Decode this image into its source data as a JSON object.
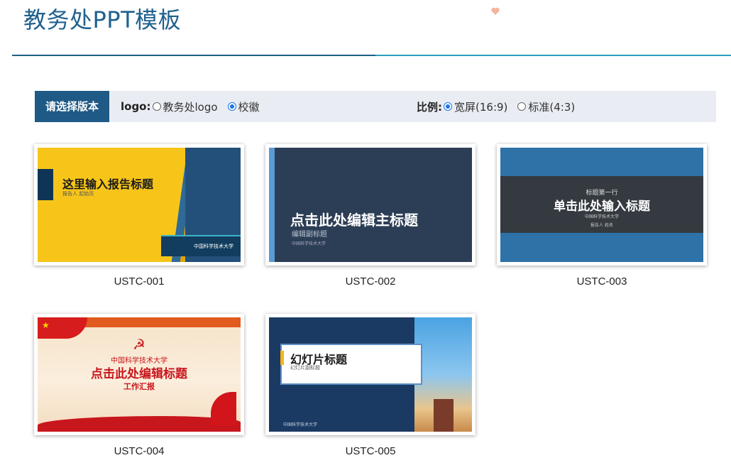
{
  "header": {
    "title": "教务处PPT模板"
  },
  "filter": {
    "head_label": "请选择版本",
    "logo_label": "logo:",
    "logo_options": [
      {
        "label": "教务处logo",
        "selected": false
      },
      {
        "label": "校徽",
        "selected": true
      }
    ],
    "ratio_label": "比例:",
    "ratio_options": [
      {
        "label": "宽屏(16:9)",
        "selected": true
      },
      {
        "label": "标准(4:3)",
        "selected": false
      }
    ]
  },
  "templates": [
    {
      "caption": "USTC-001",
      "thumb": {
        "title": "这里输入报告标题",
        "sub": "报告人 起始页",
        "footer": "中国科学技术大学"
      }
    },
    {
      "caption": "USTC-002",
      "thumb": {
        "title": "点击此处编辑主标题",
        "sub": "编辑副标题",
        "footer": "中国科学技术大学"
      }
    },
    {
      "caption": "USTC-003",
      "thumb": {
        "pre": "标题第一行",
        "title": "单击此处输入标题",
        "footer": "中国科学技术大学",
        "reporter": "报告人 姓名"
      }
    },
    {
      "caption": "USTC-004",
      "thumb": {
        "line1": "中国科学技术大学",
        "title": "点击此处编辑标题",
        "line3": "工作汇报",
        "emblem": "☭",
        "flag_star": "★"
      }
    },
    {
      "caption": "USTC-005",
      "thumb": {
        "title": "幻灯片标题",
        "sub": "幻灯片副标题",
        "footer": "中国科学技术大学"
      }
    }
  ],
  "colors": {
    "title": "#20618e",
    "accent": "#1f5a87",
    "bar_bg": "#e9edf3",
    "divider_dark": "#1f5f85",
    "divider_light": "#2a9fbf"
  },
  "icons": {
    "heart": "heart-icon"
  }
}
